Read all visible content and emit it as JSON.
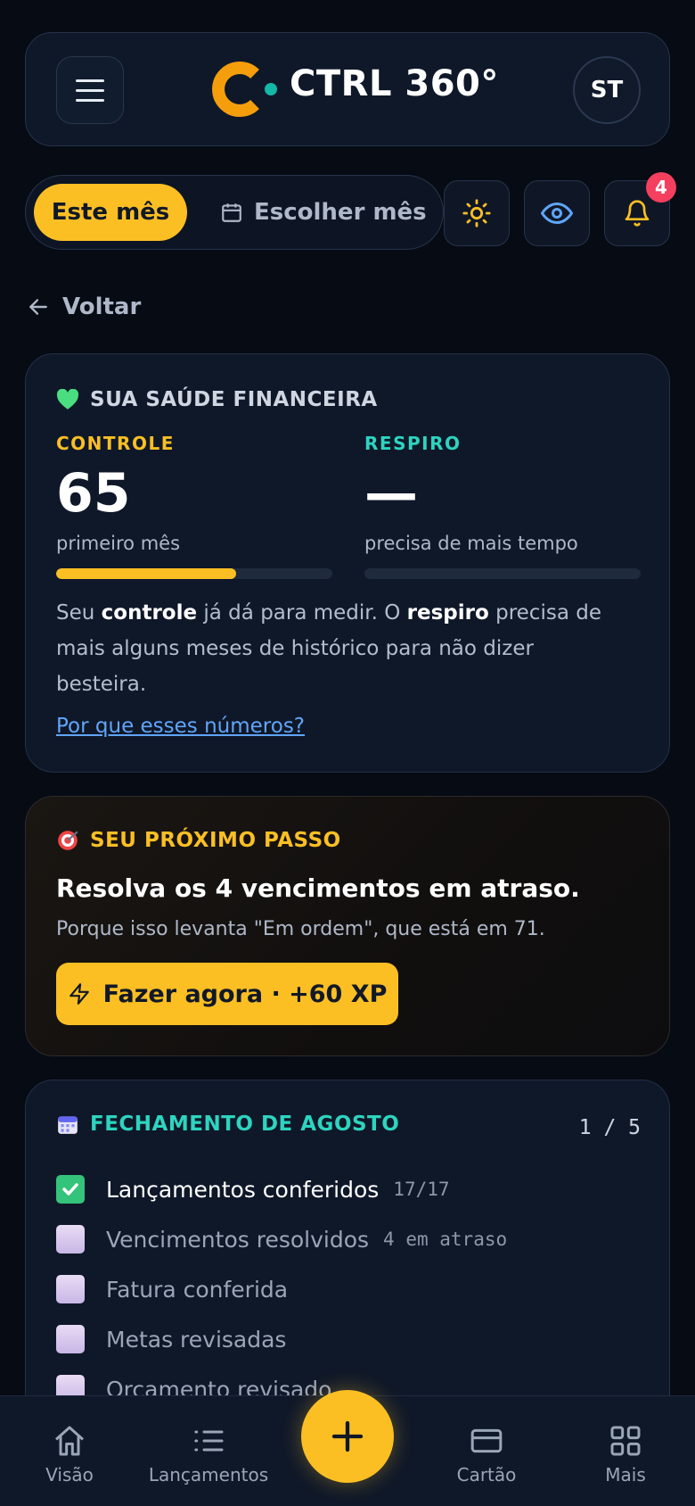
{
  "header": {
    "brand": "CTRL 360°",
    "avatar_initials": "ST",
    "menu_icon": "hamburger-icon",
    "logo_colors": {
      "arc": "#f59e0b",
      "dot": "#14b8a6"
    }
  },
  "period": {
    "active_label": "Este mês",
    "choose_label": "Escolher mês"
  },
  "toolbar": {
    "notifications_count": "4"
  },
  "nav_back": {
    "label": "Voltar"
  },
  "health": {
    "title": "SUA SAÚDE FINANCEIRA",
    "title_icon": "green-heart-icon",
    "controle": {
      "label": "CONTROLE",
      "value": "65",
      "sub": "primeiro mês",
      "progress_pct": 65,
      "color": "#fbbf24"
    },
    "respiro": {
      "label": "RESPIRO",
      "value": "—",
      "sub": "precisa de mais tempo",
      "progress_pct": 0,
      "color": "#2dd4bf"
    },
    "text_parts": [
      "Seu ",
      "controle",
      " já dá para medir. O ",
      "respiro",
      " precisa de mais alguns meses de histórico para não dizer besteira."
    ],
    "link": "Por que esses números?"
  },
  "next_step": {
    "title": "SEU PRÓXIMO PASSO",
    "title_icon": "target-icon",
    "headline": "Resolva os 4 vencimentos em atraso.",
    "reason": "Porque isso levanta \"Em ordem\", que está em 71.",
    "cta": "Fazer agora · +60 XP"
  },
  "closing": {
    "title": "FECHAMENTO DE AGOSTO",
    "title_icon": "calendar-icon",
    "progress": "1 / 5",
    "items": [
      {
        "label": "Lançamentos conferidos",
        "meta": "17/17",
        "done": true
      },
      {
        "label": "Vencimentos resolvidos",
        "meta": "4 em atraso",
        "done": false
      },
      {
        "label": "Fatura conferida",
        "meta": "",
        "done": false
      },
      {
        "label": "Metas revisadas",
        "meta": "",
        "done": false
      },
      {
        "label": "Orçamento revisado",
        "meta": "",
        "done": false
      }
    ]
  },
  "bottom_nav": {
    "items": [
      {
        "label": "Visão",
        "icon": "home-icon"
      },
      {
        "label": "Lançamentos",
        "icon": "list-icon"
      },
      {
        "label": "Cartão",
        "icon": "card-icon"
      },
      {
        "label": "Mais",
        "icon": "grid-icon"
      }
    ],
    "fab_icon": "plus-icon"
  }
}
